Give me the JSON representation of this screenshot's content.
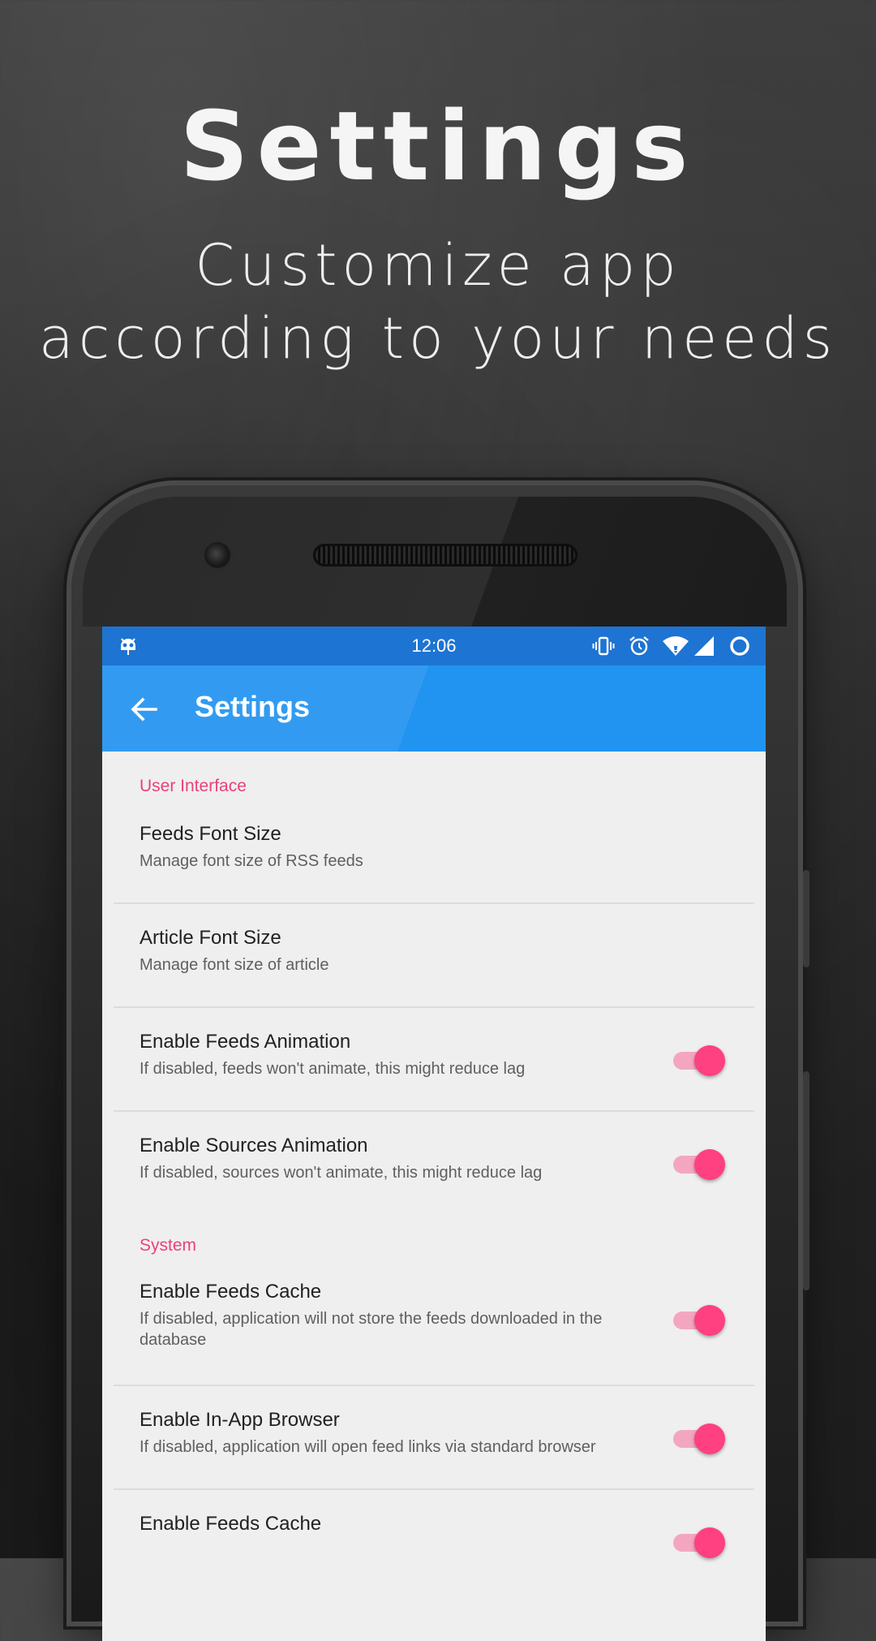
{
  "hero": {
    "title": "Settings",
    "subtitle_line1": "Customize app",
    "subtitle_line2": "according to your needs"
  },
  "status_bar": {
    "time": "12:06",
    "icons": [
      "android-ghost-icon",
      "vibrate-icon",
      "alarm-icon",
      "wifi-icon",
      "signal-icon",
      "battery-ring-icon"
    ],
    "color": "#1e74d2"
  },
  "app_bar": {
    "title": "Settings",
    "back_icon": "arrow-back-icon",
    "color": "#2193f0"
  },
  "accent_color": "#ec407a",
  "sections": [
    {
      "header": "User Interface",
      "items": [
        {
          "title": "Feeds Font Size",
          "summary": "Manage font size of RSS feeds",
          "toggle": null
        },
        {
          "title": "Article Font Size",
          "summary": "Manage font size of article",
          "toggle": null
        },
        {
          "title": "Enable Feeds Animation",
          "summary": "If disabled, feeds won't animate, this might reduce lag",
          "toggle": true
        },
        {
          "title": "Enable Sources Animation",
          "summary": "If disabled, sources won't animate, this might reduce lag",
          "toggle": true
        }
      ]
    },
    {
      "header": "System",
      "items": [
        {
          "title": "Enable Feeds Cache",
          "summary": "If disabled, application will not store the feeds downloaded in the database",
          "toggle": true
        },
        {
          "title": "Enable In-App Browser",
          "summary": "If disabled, application will open feed links via standard browser",
          "toggle": true
        },
        {
          "title": "Enable Feeds Cache",
          "summary": "",
          "toggle": true
        }
      ]
    }
  ]
}
